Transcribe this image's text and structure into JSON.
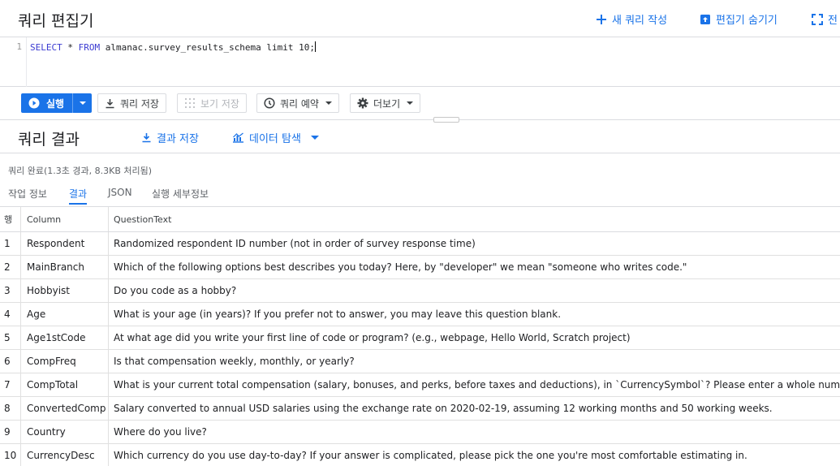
{
  "editor": {
    "title": "쿼리 편집기",
    "actions": {
      "new_query": "새 쿼리 작성",
      "hide_editor": "편집기 숨기기",
      "fullscreen": "전"
    },
    "line_number": "1",
    "code": {
      "select": "SELECT",
      "star": " * ",
      "from": "FROM",
      "rest": " almanac.survey_results_schema limit 10;"
    }
  },
  "toolbar": {
    "run": "실행",
    "save_query": "쿼리 저장",
    "save_view": "보기 저장",
    "schedule": "쿼리 예약",
    "more": "더보기"
  },
  "results": {
    "title": "쿼리 결과",
    "save_results": "결과 저장",
    "explore_data": "데이터 탐색",
    "status": "쿼리 완료(1.3초 경과, 8.3KB 처리됨)",
    "tabs": [
      "작업 정보",
      "결과",
      "JSON",
      "실행 세부정보"
    ],
    "active_tab": 1
  },
  "table": {
    "headers": [
      "행",
      "Column",
      "QuestionText"
    ],
    "rows": [
      [
        "1",
        "Respondent",
        "Randomized respondent ID number (not in order of survey response time)"
      ],
      [
        "2",
        "MainBranch",
        "Which of the following options best describes you today? Here, by \"developer\" we mean \"someone who writes code.\""
      ],
      [
        "3",
        "Hobbyist",
        "Do you code as a hobby?"
      ],
      [
        "4",
        "Age",
        "What is your age (in years)? If you prefer not to answer, you may leave this question blank."
      ],
      [
        "5",
        "Age1stCode",
        "At what age did you write your first line of code or program? (e.g., webpage, Hello World, Scratch project)"
      ],
      [
        "6",
        "CompFreq",
        "Is that compensation weekly, monthly, or yearly?"
      ],
      [
        "7",
        "CompTotal",
        "What is your current total compensation (salary, bonuses, and perks, before taxes and deductions), in `CurrencySymbol`? Please enter a whole number in the box below, without any c"
      ],
      [
        "8",
        "ConvertedComp",
        "Salary converted to annual USD salaries using the exchange rate on 2020-02-19, assuming 12 working months and 50 working weeks."
      ],
      [
        "9",
        "Country",
        "Where do you live?"
      ],
      [
        "10",
        "CurrencyDesc",
        "Which currency do you use day-to-day? If your answer is complicated, please pick the one you're most comfortable estimating in."
      ]
    ]
  },
  "colors": {
    "accent": "#1a73e8",
    "keyword": "#3b3bd1",
    "border": "#dadce0"
  },
  "icons": [
    "plus-icon",
    "hide-editor-icon",
    "fullscreen-icon",
    "play-icon",
    "download-icon",
    "grid-icon",
    "clock-icon",
    "gear-icon",
    "explore-icon"
  ]
}
